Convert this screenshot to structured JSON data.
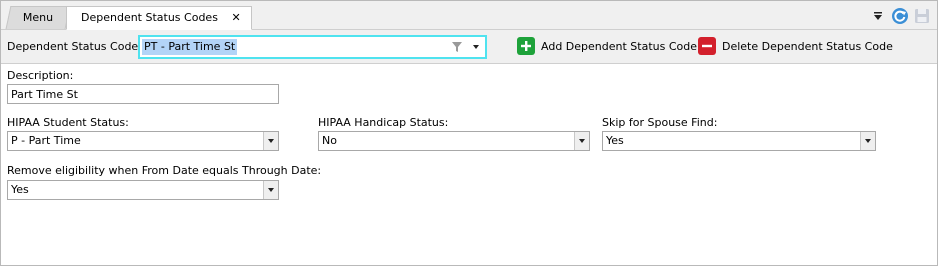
{
  "tabs": [
    {
      "label": "Menu"
    },
    {
      "label": "Dependent Status Codes",
      "close_glyph": "✕"
    }
  ],
  "toolbar": {
    "code_label": "Dependent Status Code:",
    "code_value": "PT - Part Time St",
    "add_label": "Add Dependent Status Code",
    "delete_label": "Delete Dependent Status Code"
  },
  "form": {
    "description_label": "Description:",
    "description_value": "Part Time St",
    "hipaa_student_label": "HIPAA Student Status:",
    "hipaa_student_value": "P - Part Time",
    "hipaa_handicap_label": "HIPAA Handicap Status:",
    "hipaa_handicap_value": "No",
    "skip_spouse_label": "Skip for Spouse Find:",
    "skip_spouse_value": "Yes",
    "remove_elig_label": "Remove eligibility when From Date equals Through Date:",
    "remove_elig_value": "Yes"
  },
  "colors": {
    "add": "#1ea23a",
    "delete": "#d3202c",
    "focus": "#4fe3ef",
    "selection": "#b3d4f7"
  }
}
